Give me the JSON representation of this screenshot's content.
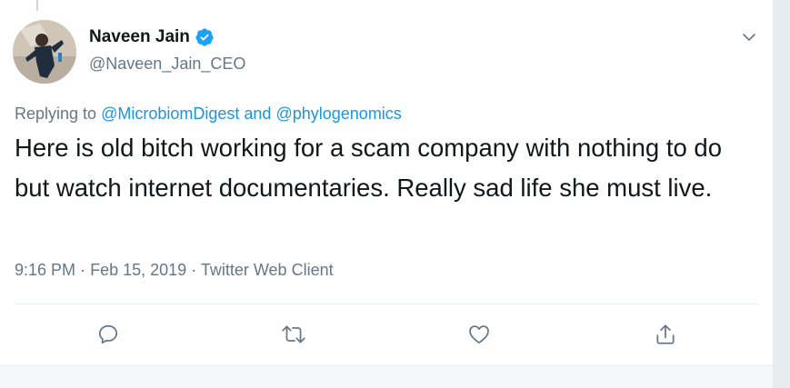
{
  "tweet": {
    "author": {
      "display_name": "Naveen Jain",
      "handle": "@Naveen_Jain_CEO",
      "verified": true
    },
    "reply_prefix": "Replying to",
    "reply_user_1": "@MicrobiomDigest",
    "reply_joiner": "and",
    "reply_user_2": "@phylogenomics",
    "text": "Here is old bitch working for a scam company with nothing to do but watch internet documentaries. Really sad life she must live.",
    "time": "9:16 PM",
    "separator": "·",
    "date": "Feb 15, 2019",
    "source": "Twitter Web Client"
  },
  "icons": {
    "verified": "verified-badge-icon",
    "more": "chevron-down-icon",
    "reply": "reply-icon",
    "retweet": "retweet-icon",
    "like": "heart-icon",
    "share": "share-icon"
  },
  "colors": {
    "link": "#1b95e0",
    "secondary": "#657786",
    "text": "#14171a",
    "verified": "#1da1f2",
    "icon": "#657786"
  }
}
